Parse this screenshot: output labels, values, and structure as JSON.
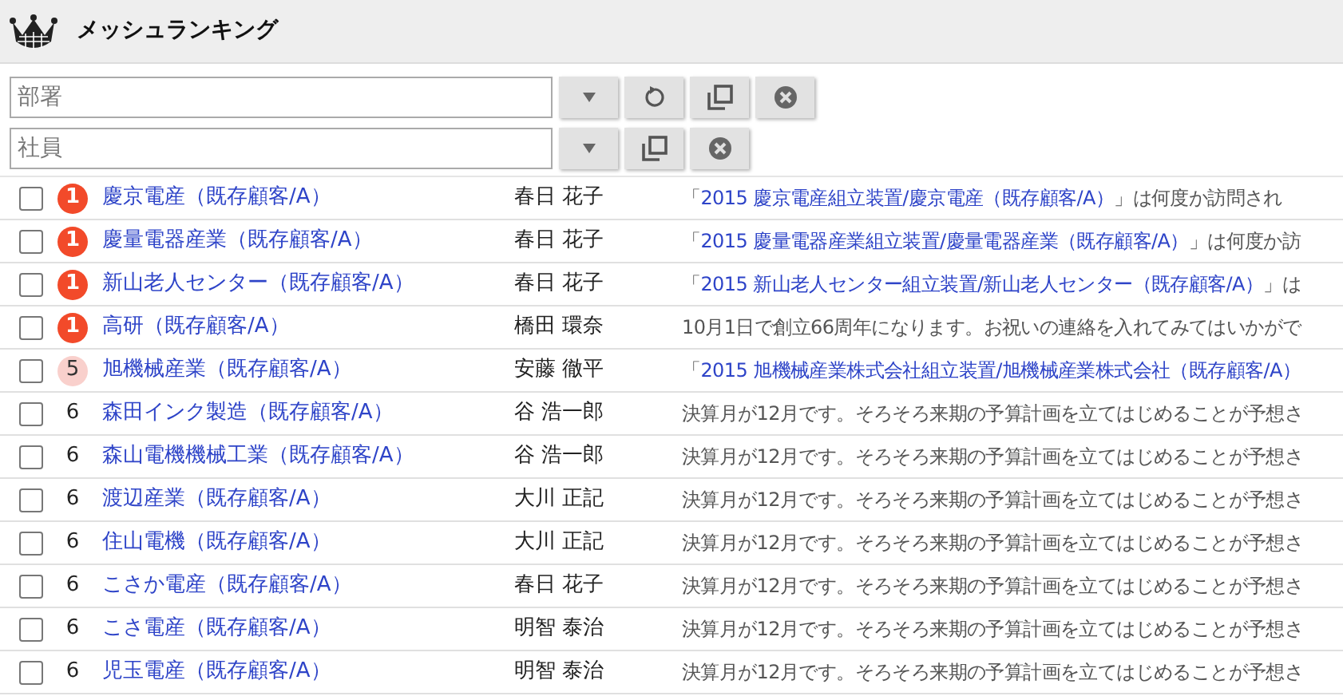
{
  "header": {
    "title": "メッシュランキング"
  },
  "filters": [
    {
      "placeholder": "部署",
      "buttons": [
        {
          "kind": "dropdown"
        },
        {
          "kind": "reset"
        },
        {
          "kind": "copy"
        },
        {
          "kind": "clear"
        }
      ]
    },
    {
      "placeholder": "社員",
      "buttons": [
        {
          "kind": "dropdown"
        },
        {
          "kind": "copy"
        },
        {
          "kind": "clear"
        }
      ]
    }
  ],
  "rows": [
    {
      "checked": false,
      "rank": {
        "text": "1",
        "kind": "urgent"
      },
      "company": "慶京電産（既存顧客/A）",
      "person": "春日 花子",
      "note": {
        "kind": "link",
        "prefix": "「",
        "link": "2015 慶京電産組立装置/慶京電産（既存顧客/A）",
        "suffix": "」は何度か訪問され"
      }
    },
    {
      "checked": false,
      "rank": {
        "text": "1",
        "kind": "urgent"
      },
      "company": "慶量電器産業（既存顧客/A）",
      "person": "春日 花子",
      "note": {
        "kind": "link",
        "prefix": "「",
        "link": "2015 慶量電器産業組立装置/慶量電器産業（既存顧客/A）",
        "suffix": "」は何度か訪"
      }
    },
    {
      "checked": false,
      "rank": {
        "text": "1",
        "kind": "urgent"
      },
      "company": "新山老人センター（既存顧客/A）",
      "person": "春日 花子",
      "note": {
        "kind": "link",
        "prefix": "「",
        "link": "2015 新山老人センター組立装置/新山老人センター（既存顧客/A）",
        "suffix": "」は"
      }
    },
    {
      "checked": false,
      "rank": {
        "text": "1",
        "kind": "urgent"
      },
      "company": "高研（既存顧客/A）",
      "person": "橋田 環奈",
      "note": {
        "kind": "plain",
        "text": "10月1日で創立66周年になります。お祝いの連絡を入れてみてはいかがで"
      }
    },
    {
      "checked": false,
      "rank": {
        "text": "5",
        "kind": "warm"
      },
      "company": "旭機械産業（既存顧客/A）",
      "person": "安藤 徹平",
      "note": {
        "kind": "link",
        "prefix": "「",
        "link": "2015 旭機械産業株式会社組立装置/旭機械産業株式会社（既存顧客/A）"
      }
    },
    {
      "checked": false,
      "rank": {
        "text": "6",
        "kind": "plain"
      },
      "company": "森田インク製造（既存顧客/A）",
      "person": "谷 浩一郎",
      "note": {
        "kind": "plain",
        "text": "決算月が12月です。そろそろ来期の予算計画を立てはじめることが予想さ"
      }
    },
    {
      "checked": false,
      "rank": {
        "text": "6",
        "kind": "plain"
      },
      "company": "森山電機機械工業（既存顧客/A）",
      "person": "谷 浩一郎",
      "note": {
        "kind": "plain",
        "text": "決算月が12月です。そろそろ来期の予算計画を立てはじめることが予想さ"
      }
    },
    {
      "checked": false,
      "rank": {
        "text": "6",
        "kind": "plain"
      },
      "company": "渡辺産業（既存顧客/A）",
      "person": "大川 正記",
      "note": {
        "kind": "plain",
        "text": "決算月が12月です。そろそろ来期の予算計画を立てはじめることが予想さ"
      }
    },
    {
      "checked": false,
      "rank": {
        "text": "6",
        "kind": "plain"
      },
      "company": "住山電機（既存顧客/A）",
      "person": "大川 正記",
      "note": {
        "kind": "plain",
        "text": "決算月が12月です。そろそろ来期の予算計画を立てはじめることが予想さ"
      }
    },
    {
      "checked": false,
      "rank": {
        "text": "6",
        "kind": "plain"
      },
      "company": "こさか電産（既存顧客/A）",
      "person": "春日 花子",
      "note": {
        "kind": "plain",
        "text": "決算月が12月です。そろそろ来期の予算計画を立てはじめることが予想さ"
      }
    },
    {
      "checked": false,
      "rank": {
        "text": "6",
        "kind": "plain"
      },
      "company": "こさ電産（既存顧客/A）",
      "person": "明智 泰治",
      "note": {
        "kind": "plain",
        "text": "決算月が12月です。そろそろ来期の予算計画を立てはじめることが予想さ"
      }
    },
    {
      "checked": false,
      "rank": {
        "text": "6",
        "kind": "plain"
      },
      "company": "児玉電産（既存顧客/A）",
      "person": "明智 泰治",
      "note": {
        "kind": "plain",
        "text": "決算月が12月です。そろそろ来期の予算計画を立てはじめることが予想さ"
      }
    }
  ]
}
